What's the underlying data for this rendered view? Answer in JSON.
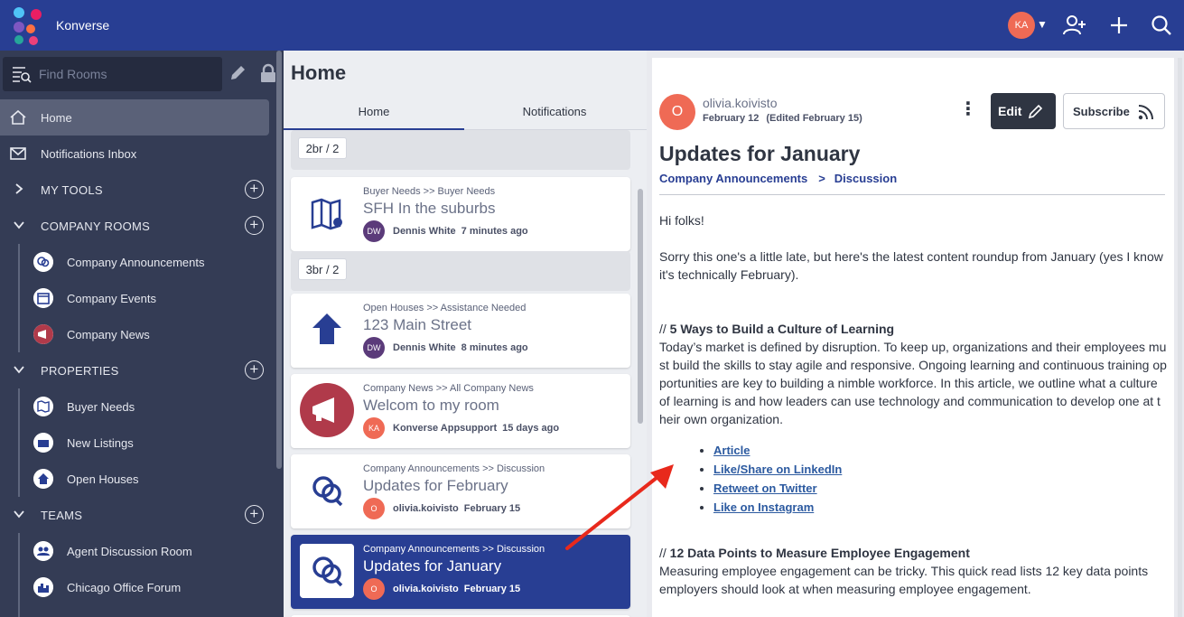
{
  "app": {
    "title": "Konverse",
    "user_initials": "KA"
  },
  "sidebar": {
    "search_placeholder": "Find Rooms",
    "items": [
      {
        "label": "Home"
      },
      {
        "label": "Notifications Inbox"
      }
    ],
    "sections": [
      {
        "label": "MY TOOLS"
      },
      {
        "label": "COMPANY ROOMS"
      },
      {
        "label": "PROPERTIES"
      },
      {
        "label": "TEAMS"
      }
    ],
    "company_rooms": [
      {
        "label": "Company Announcements"
      },
      {
        "label": "Company Events"
      },
      {
        "label": "Company News"
      }
    ],
    "properties": [
      {
        "label": "Buyer Needs"
      },
      {
        "label": "New Listings"
      },
      {
        "label": "Open Houses"
      }
    ],
    "teams": [
      {
        "label": "Agent Discussion Room"
      },
      {
        "label": "Chicago Office Forum"
      }
    ]
  },
  "middle": {
    "title": "Home",
    "tabs": [
      {
        "label": "Home"
      },
      {
        "label": "Notifications"
      }
    ],
    "badges": [
      {
        "label": "2br / 2"
      },
      {
        "label": "3br / 2"
      }
    ],
    "cards": [
      {
        "crumb": "Buyer Needs >> Buyer Needs",
        "title": "SFH In the suburbs",
        "initials": "DW",
        "author": "Dennis White",
        "when": "7 minutes ago"
      },
      {
        "crumb": "Open Houses >> Assistance Needed",
        "title": "123 Main Street",
        "initials": "DW",
        "author": "Dennis White",
        "when": "8 minutes ago"
      },
      {
        "crumb": "Company News >> All Company News",
        "title": "Welcom to my room",
        "initials": "KA",
        "author": "Konverse Appsupport",
        "when": "15 days ago"
      },
      {
        "crumb": "Company Announcements >> Discussion",
        "title": "Updates for February",
        "initials": "O",
        "author": "olivia.koivisto",
        "when": "February 15"
      },
      {
        "crumb": "Company Announcements >> Discussion",
        "title": "Updates for January",
        "initials": "O",
        "author": "olivia.koivisto",
        "when": "February 15"
      }
    ]
  },
  "post": {
    "initial": "O",
    "user": "olivia.koivisto",
    "date": "February 12",
    "edited": "(Edited February 15)",
    "edit_label": "Edit",
    "subscribe_label": "Subscribe",
    "title": "Updates for January",
    "crumb_room": "Company Announcements",
    "crumb_sep": ">",
    "crumb_topic": "Discussion",
    "greeting": "Hi folks!",
    "intro": "Sorry this one's a little late, but here's the latest content roundup from January (yes I know it's technically February).",
    "s1_prefix": "// ",
    "s1_heading": "5 Ways to Build a Culture of Learning",
    "s1_body": "Today’s market is defined by disruption. To keep up, organizations and their employees must build the skills to stay agile and responsive. Ongoing learning and continuous training opportunities are key to building a nimble workforce. In this article, we outline  what a culture of learning is and how leaders can use technology and communication to develop one at their own organization.",
    "links": [
      "Article",
      "Like/Share on LinkedIn",
      "Retweet on Twitter",
      "Like on Instagram"
    ],
    "s2_prefix": "// ",
    "s2_heading": "12 Data Points to Measure Employee Engagement",
    "s2_body": "Measuring employee engagement can be tricky. This quick read lists 12 key data points employers should look at when measuring employee engagement."
  },
  "colors": {
    "topbar": "#283e93",
    "sidebar": "#343c55",
    "accent": "#283e93",
    "avatar": "#ef6a55",
    "annotation": "#e8291c"
  }
}
